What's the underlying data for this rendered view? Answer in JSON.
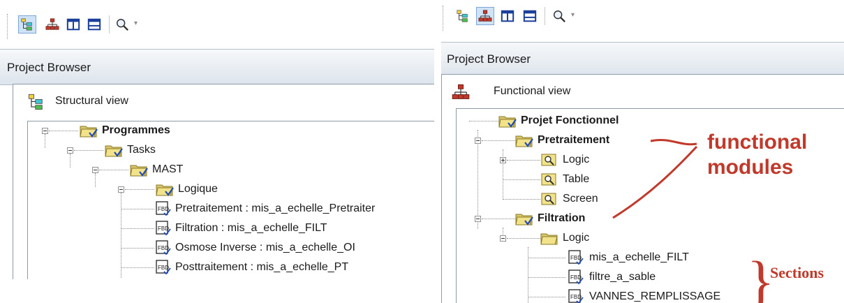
{
  "left": {
    "panel_title": "Project Browser",
    "view_label": "Structural view",
    "tree": [
      {
        "label": "Programmes",
        "bold": true
      },
      {
        "label": "Tasks",
        "bold": false
      },
      {
        "label": "MAST",
        "bold": false
      },
      {
        "label": "Logique",
        "bold": false
      },
      {
        "label": "Pretraitement : mis_a_echelle_Pretraiter",
        "bold": false
      },
      {
        "label": "Filtration : mis_a_echelle_FILT",
        "bold": false
      },
      {
        "label": "Osmose Inverse : mis_a_echelle_OI",
        "bold": false
      },
      {
        "label": "Posttraitement : mis_a_echelle_PT",
        "bold": false
      }
    ]
  },
  "right": {
    "panel_title": "Project Browser",
    "view_label": "Functional view",
    "tree": [
      {
        "label": "Projet Fonctionnel",
        "bold": true
      },
      {
        "label": "Pretraitement",
        "bold": true
      },
      {
        "label": "Logic",
        "bold": false
      },
      {
        "label": "Table",
        "bold": false
      },
      {
        "label": "Screen",
        "bold": false
      },
      {
        "label": "Filtration",
        "bold": true
      },
      {
        "label": "Logic",
        "bold": false
      },
      {
        "label": "mis_a_echelle_FILT",
        "bold": false
      },
      {
        "label": "filtre_a_sable",
        "bold": false
      },
      {
        "label": "VANNES_REMPLISSAGE",
        "bold": false
      }
    ]
  },
  "annotations": {
    "functional_modules_line1": "functional",
    "functional_modules_line2": "modules",
    "sections": "Sections",
    "color": "#c0392b"
  },
  "toolbar": {
    "buttons": [
      "structural-view-icon",
      "functional-view-icon",
      "split-vertical-icon",
      "split-horizontal-icon",
      "zoom-icon"
    ],
    "dropdown_glyph": "▾"
  },
  "icons": {
    "folder": "folder-icon",
    "folder_module": "module-folder-icon",
    "section": "fbd-section-icon",
    "table_screen": "table-icon"
  }
}
